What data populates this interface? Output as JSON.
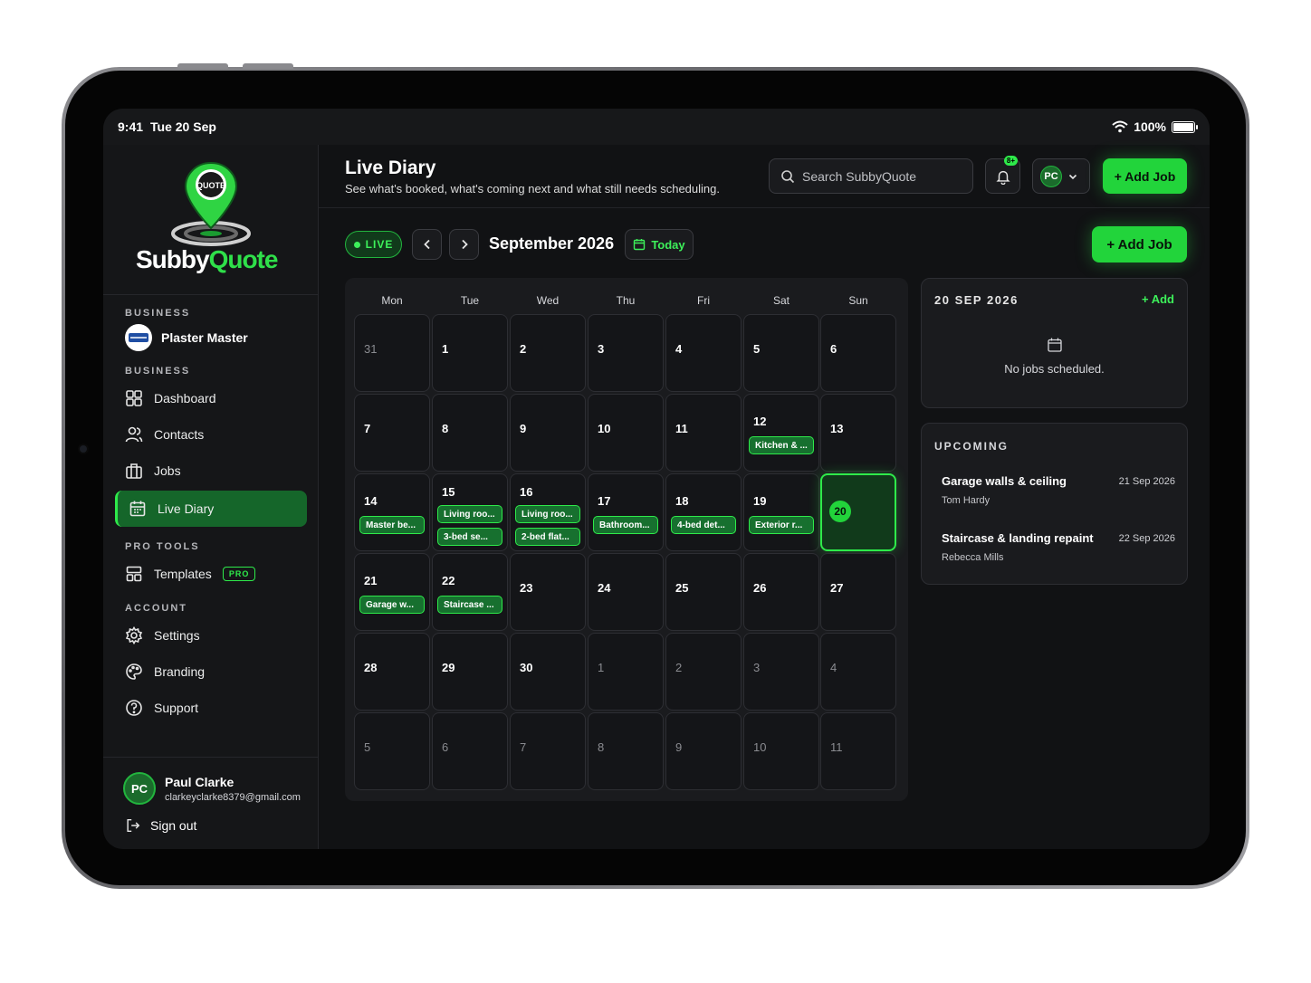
{
  "status": {
    "time": "9:41",
    "date": "Tue 20 Sep",
    "battery": "100%"
  },
  "brand": {
    "logo_pin": "QUOTE",
    "name_part1": "Subby",
    "name_part2": "Quote"
  },
  "sidebar": {
    "business_label": "BUSINESS",
    "business_name": "Plaster Master",
    "nav_label": "BUSINESS",
    "items": [
      {
        "label": "Dashboard",
        "icon": "dashboard-icon"
      },
      {
        "label": "Contacts",
        "icon": "contacts-icon"
      },
      {
        "label": "Jobs",
        "icon": "briefcase-icon"
      },
      {
        "label": "Live Diary",
        "icon": "calendar-icon",
        "active": true
      }
    ],
    "pro_label": "PRO TOOLS",
    "templates": {
      "label": "Templates",
      "badge": "PRO"
    },
    "account_label": "ACCOUNT",
    "account_items": [
      {
        "label": "Settings",
        "icon": "gear-icon"
      },
      {
        "label": "Branding",
        "icon": "palette-icon"
      },
      {
        "label": "Support",
        "icon": "help-icon"
      }
    ],
    "user": {
      "initials": "PC",
      "name": "Paul Clarke",
      "email": "clarkeyclarke8379@gmail.com"
    },
    "signout": "Sign out"
  },
  "header": {
    "title": "Live Diary",
    "subtitle": "See what's booked, what's coming next and what still needs scheduling.",
    "search_placeholder": "Search SubbyQuote",
    "notif_count": "8+",
    "account_initials": "PC",
    "add_job": "+ Add Job"
  },
  "toolbar": {
    "live": "LIVE",
    "month": "September 2026",
    "today": "Today",
    "add_job": "+ Add Job"
  },
  "calendar": {
    "weekdays": [
      "Mon",
      "Tue",
      "Wed",
      "Thu",
      "Fri",
      "Sat",
      "Sun"
    ],
    "weeks": [
      [
        {
          "d": "31",
          "m": false
        },
        {
          "d": "1"
        },
        {
          "d": "2"
        },
        {
          "d": "3"
        },
        {
          "d": "4"
        },
        {
          "d": "5"
        },
        {
          "d": "6"
        }
      ],
      [
        {
          "d": "7"
        },
        {
          "d": "8"
        },
        {
          "d": "9"
        },
        {
          "d": "10"
        },
        {
          "d": "11"
        },
        {
          "d": "12",
          "jobs": [
            "Kitchen & ..."
          ]
        },
        {
          "d": "13"
        }
      ],
      [
        {
          "d": "14",
          "jobs": [
            "Master be..."
          ]
        },
        {
          "d": "15",
          "jobs": [
            "Living roo...",
            "3-bed se..."
          ]
        },
        {
          "d": "16",
          "jobs": [
            "Living roo...",
            "2-bed flat..."
          ]
        },
        {
          "d": "17",
          "jobs": [
            "Bathroom..."
          ]
        },
        {
          "d": "18",
          "jobs": [
            "4-bed det..."
          ]
        },
        {
          "d": "19",
          "jobs": [
            "Exterior r..."
          ]
        },
        {
          "d": "20",
          "today": true
        }
      ],
      [
        {
          "d": "21",
          "jobs": [
            "Garage w..."
          ]
        },
        {
          "d": "22",
          "jobs": [
            "Staircase ..."
          ]
        },
        {
          "d": "23"
        },
        {
          "d": "24"
        },
        {
          "d": "25"
        },
        {
          "d": "26"
        },
        {
          "d": "27"
        }
      ],
      [
        {
          "d": "28"
        },
        {
          "d": "29"
        },
        {
          "d": "30"
        },
        {
          "d": "1",
          "m": false
        },
        {
          "d": "2",
          "m": false
        },
        {
          "d": "3",
          "m": false
        },
        {
          "d": "4",
          "m": false
        }
      ],
      [
        {
          "d": "5",
          "m": false
        },
        {
          "d": "6",
          "m": false
        },
        {
          "d": "7",
          "m": false
        },
        {
          "d": "8",
          "m": false
        },
        {
          "d": "9",
          "m": false
        },
        {
          "d": "10",
          "m": false
        },
        {
          "d": "11",
          "m": false
        }
      ]
    ]
  },
  "day_panel": {
    "date": "20 SEP 2026",
    "add": "+ Add",
    "empty": "No jobs scheduled."
  },
  "upcoming": {
    "label": "UPCOMING",
    "items": [
      {
        "title": "Garage walls & ceiling",
        "date": "21 Sep 2026",
        "client": "Tom Hardy"
      },
      {
        "title": "Staircase & landing repaint",
        "date": "22 Sep 2026",
        "client": "Rebecca Mills"
      }
    ]
  },
  "colors": {
    "accent": "#2eea4a",
    "accent_dark": "#17702f",
    "bg": "#111214",
    "panel": "#1a1b1e"
  }
}
